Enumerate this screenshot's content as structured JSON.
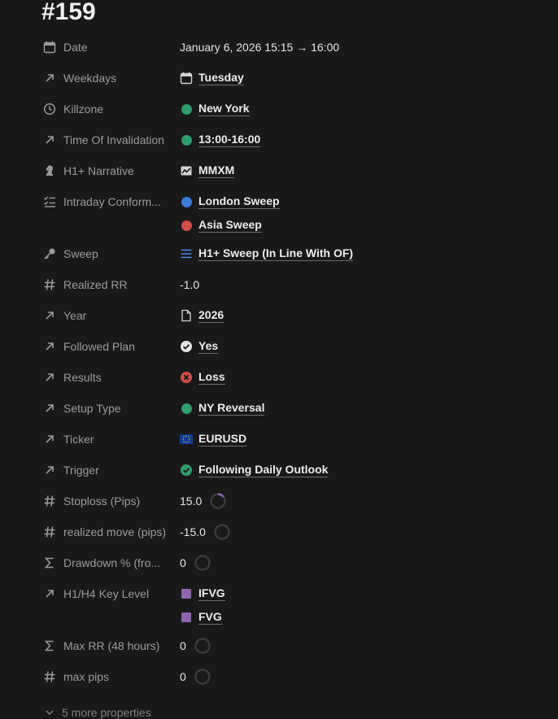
{
  "page": {
    "title": "#159"
  },
  "properties": [
    {
      "name": "Date",
      "icon": "calendar-icon",
      "values": [
        {
          "text": "January 6, 2026 15:15 → 16:00",
          "style": "plain"
        }
      ]
    },
    {
      "name": "Weekdays",
      "icon": "arrow-up-right-icon",
      "values": [
        {
          "text": "Tuesday",
          "style": "link",
          "icon": "calendar-icon"
        }
      ]
    },
    {
      "name": "Killzone",
      "icon": "clock-icon",
      "values": [
        {
          "text": "New York",
          "style": "link",
          "icon": "dot",
          "color": "#2f9e6e"
        }
      ]
    },
    {
      "name": "Time Of Invalidation",
      "icon": "arrow-up-right-icon",
      "values": [
        {
          "text": "13:00-16:00",
          "style": "link",
          "icon": "dot",
          "color": "#2f9e6e"
        }
      ]
    },
    {
      "name": "H1+ Narrative",
      "icon": "chess-knight-icon",
      "values": [
        {
          "text": "MMXM",
          "style": "link",
          "icon": "chart-icon"
        }
      ]
    },
    {
      "name": "Intraday Conform...",
      "icon": "checklist-icon",
      "values": [
        {
          "text": "London Sweep",
          "style": "link",
          "icon": "dot",
          "color": "#3b7dd8"
        },
        {
          "text": "Asia Sweep",
          "style": "link",
          "icon": "dot",
          "color": "#d44c47"
        }
      ]
    },
    {
      "name": "Sweep",
      "icon": "key-icon",
      "values": [
        {
          "text": "H1+ Sweep (In Line With OF)",
          "style": "link",
          "icon": "list-icon",
          "color": "#4a86e8"
        }
      ]
    },
    {
      "name": "Realized RR",
      "icon": "hash-icon",
      "values": [
        {
          "text": "-1.0",
          "style": "plain"
        }
      ]
    },
    {
      "name": "Year",
      "icon": "arrow-up-right-icon",
      "values": [
        {
          "text": "2026",
          "style": "link",
          "icon": "page-icon"
        }
      ]
    },
    {
      "name": "Followed Plan",
      "icon": "arrow-up-right-icon",
      "values": [
        {
          "text": "Yes",
          "style": "link",
          "icon": "check-circle-icon",
          "color": "#e6e6e6"
        }
      ]
    },
    {
      "name": "Results",
      "icon": "arrow-up-right-icon",
      "values": [
        {
          "text": "Loss",
          "style": "link",
          "icon": "x-circle-icon",
          "color": "#d44c47"
        }
      ]
    },
    {
      "name": "Setup Type",
      "icon": "arrow-up-right-icon",
      "values": [
        {
          "text": "NY Reversal",
          "style": "link",
          "icon": "dot",
          "color": "#2f9e6e"
        }
      ]
    },
    {
      "name": "Ticker",
      "icon": "arrow-up-right-icon",
      "values": [
        {
          "text": "EURUSD",
          "style": "link",
          "icon": "eu-flag-icon"
        }
      ]
    },
    {
      "name": "Trigger",
      "icon": "arrow-up-right-icon",
      "values": [
        {
          "text": "Following Daily Outlook",
          "style": "link",
          "icon": "check-circle-icon",
          "color": "#2f9e6e"
        }
      ]
    },
    {
      "name": "Stoploss (Pips)",
      "icon": "hash-icon",
      "values": [
        {
          "text": "15.0",
          "style": "plain",
          "progress": 0.15,
          "ring_color": "#9065b0"
        }
      ]
    },
    {
      "name": "realized move (pips)",
      "icon": "hash-icon",
      "values": [
        {
          "text": "-15.0",
          "style": "plain",
          "progress": 0
        }
      ]
    },
    {
      "name": "Drawdown % (fro...",
      "icon": "sigma-icon",
      "values": [
        {
          "text": "0",
          "style": "plain",
          "progress": 0
        }
      ]
    },
    {
      "name": "H1/H4 Key Level",
      "icon": "arrow-up-right-icon",
      "values": [
        {
          "text": "IFVG",
          "style": "link",
          "icon": "square",
          "color": "#9065b0"
        },
        {
          "text": "FVG",
          "style": "link",
          "icon": "square",
          "color": "#9065b0"
        }
      ]
    },
    {
      "name": "Max RR (48 hours)",
      "icon": "sigma-icon",
      "values": [
        {
          "text": "0",
          "style": "plain",
          "progress": 0
        }
      ]
    },
    {
      "name": "max pips",
      "icon": "hash-icon",
      "values": [
        {
          "text": "0",
          "style": "plain",
          "progress": 0
        }
      ]
    }
  ],
  "footer": {
    "more_label": "5 more properties"
  }
}
